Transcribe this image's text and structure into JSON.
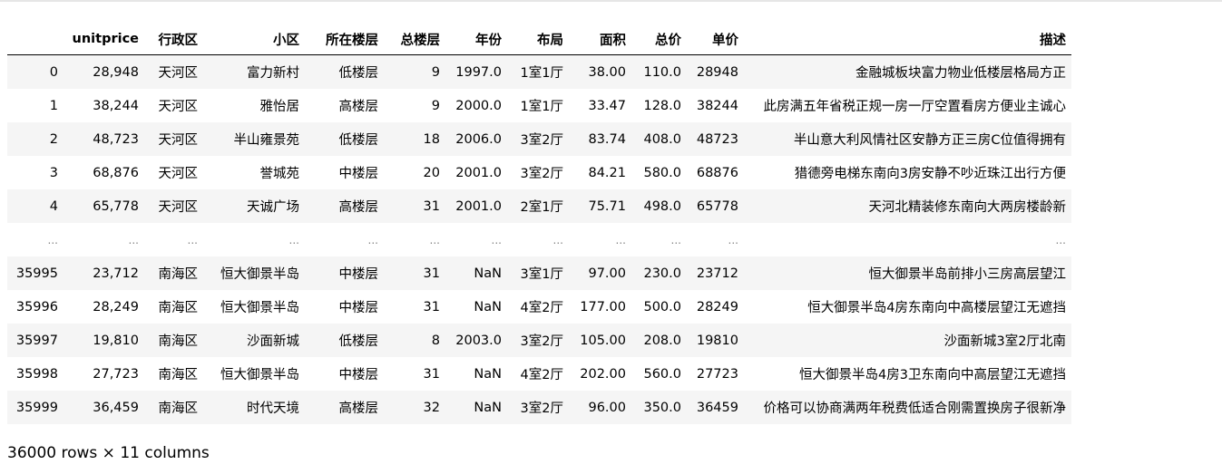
{
  "table": {
    "columns": [
      "",
      "unitprice",
      "行政区",
      "小区",
      "所在楼层",
      "总楼层",
      "年份",
      "布局",
      "面积",
      "总价",
      "单价",
      "描述"
    ],
    "rows": [
      {
        "index": "0",
        "cells": [
          "28,948",
          "天河区",
          "富力新村",
          "低楼层",
          "9",
          "1997.0",
          "1室1厅",
          "38.00",
          "110.0",
          "28948",
          "金融城板块富力物业低楼层格局方正"
        ]
      },
      {
        "index": "1",
        "cells": [
          "38,244",
          "天河区",
          "雅怡居",
          "高楼层",
          "9",
          "2000.0",
          "1室1厅",
          "33.47",
          "128.0",
          "38244",
          "此房满五年省税正规一房一厅空置看房方便业主诚心"
        ]
      },
      {
        "index": "2",
        "cells": [
          "48,723",
          "天河区",
          "半山雍景苑",
          "低楼层",
          "18",
          "2006.0",
          "3室2厅",
          "83.74",
          "408.0",
          "48723",
          "半山意大利风情社区安静方正三房C位值得拥有"
        ]
      },
      {
        "index": "3",
        "cells": [
          "68,876",
          "天河区",
          "誉城苑",
          "中楼层",
          "20",
          "2001.0",
          "3室2厅",
          "84.21",
          "580.0",
          "68876",
          "猎德旁电梯东南向3房安静不吵近珠江出行方便"
        ]
      },
      {
        "index": "4",
        "cells": [
          "65,778",
          "天河区",
          "天诚广场",
          "高楼层",
          "31",
          "2001.0",
          "2室1厅",
          "75.71",
          "498.0",
          "65778",
          "天河北精装修东南向大两房楼龄新"
        ]
      },
      {
        "index": "...",
        "cells": [
          "...",
          "...",
          "...",
          "...",
          "...",
          "...",
          "...",
          "...",
          "...",
          "...",
          "..."
        ],
        "ellipsis": true
      },
      {
        "index": "35995",
        "cells": [
          "23,712",
          "南海区",
          "恒大御景半岛",
          "中楼层",
          "31",
          "NaN",
          "3室1厅",
          "97.00",
          "230.0",
          "23712",
          "恒大御景半岛前排小三房高层望江"
        ]
      },
      {
        "index": "35996",
        "cells": [
          "28,249",
          "南海区",
          "恒大御景半岛",
          "中楼层",
          "31",
          "NaN",
          "4室2厅",
          "177.00",
          "500.0",
          "28249",
          "恒大御景半岛4房东南向中高楼层望江无遮挡"
        ]
      },
      {
        "index": "35997",
        "cells": [
          "19,810",
          "南海区",
          "沙面新城",
          "低楼层",
          "8",
          "2003.0",
          "3室2厅",
          "105.00",
          "208.0",
          "19810",
          "沙面新城3室2厅北南"
        ]
      },
      {
        "index": "35998",
        "cells": [
          "27,723",
          "南海区",
          "恒大御景半岛",
          "中楼层",
          "31",
          "NaN",
          "4室2厅",
          "202.00",
          "560.0",
          "27723",
          "恒大御景半岛4房3卫东南向中高层望江无遮挡"
        ]
      },
      {
        "index": "35999",
        "cells": [
          "36,459",
          "南海区",
          "时代天境",
          "高楼层",
          "32",
          "NaN",
          "3室2厅",
          "96.00",
          "350.0",
          "36459",
          "价格可以协商满两年税费低适合刚需置换房子很新净"
        ]
      }
    ]
  },
  "shape_info": "36000 rows × 11 columns",
  "colors": {
    "stripe": "#f5f5f5",
    "header_rule": "#000000",
    "ellipsis_text": "#888888"
  }
}
